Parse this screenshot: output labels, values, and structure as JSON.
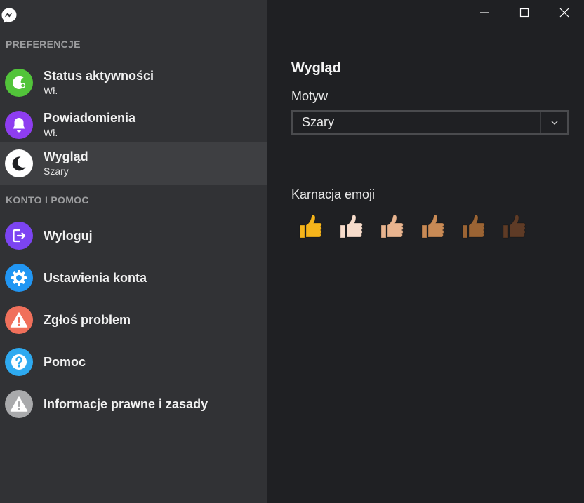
{
  "sidebar": {
    "sections": {
      "preferences": "PREFERENCJE",
      "account": "KONTO I POMOC"
    },
    "items": [
      {
        "label": "Status aktywności",
        "sub": "Wł.",
        "icon": "activity-status-icon",
        "color": "#52c43a"
      },
      {
        "label": "Powiadomienia",
        "sub": "Wł.",
        "icon": "bell-icon",
        "color": "#8e3df0"
      },
      {
        "label": "Wygląd",
        "sub": "Szary",
        "icon": "moon-icon",
        "color": "#ffffff"
      },
      {
        "label": "Wyloguj",
        "icon": "logout-icon",
        "color": "#7c44f2"
      },
      {
        "label": "Ustawienia konta",
        "icon": "gear-icon",
        "color": "#2196f3"
      },
      {
        "label": "Zgłoś problem",
        "icon": "warning-icon",
        "color": "#f0705b"
      },
      {
        "label": "Pomoc",
        "icon": "help-icon",
        "color": "#2eaaf0"
      },
      {
        "label": "Informacje prawne i zasady",
        "icon": "warning-icon",
        "color": "#a9aaac"
      }
    ]
  },
  "main": {
    "title": "Wygląd",
    "theme_label": "Motyw",
    "theme_value": "Szary",
    "emoji_label": "Karnacja emoji",
    "emoji_tones": [
      "#f5b41b",
      "#f7dccb",
      "#e8b48f",
      "#c88a55",
      "#9b6434",
      "#5e3b26"
    ]
  },
  "colors": {
    "sidebar_bg": "#313235",
    "main_bg": "#1f2023",
    "selected_bg": "#3e3f42"
  }
}
